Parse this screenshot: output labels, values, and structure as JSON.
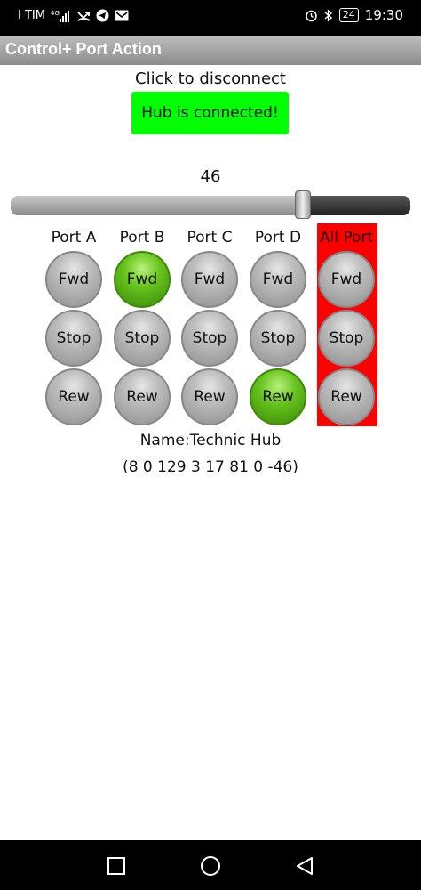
{
  "status": {
    "carrier": "I TIM",
    "network": "4G",
    "battery": "24",
    "time": "19:30"
  },
  "appbar": {
    "title": "Control+ Port Action"
  },
  "connection": {
    "hint": "Click to disconnect",
    "button_label": "Hub is connected!"
  },
  "speed": {
    "value_label": "46",
    "value": 46,
    "min": -100,
    "max": 100
  },
  "ports": [
    {
      "label": "Port A",
      "fwd": "Fwd",
      "stop": "Stop",
      "rew": "Rew",
      "active": "none"
    },
    {
      "label": "Port B",
      "fwd": "Fwd",
      "stop": "Stop",
      "rew": "Rew",
      "active": "fwd"
    },
    {
      "label": "Port C",
      "fwd": "Fwd",
      "stop": "Stop",
      "rew": "Rew",
      "active": "none"
    },
    {
      "label": "Port D",
      "fwd": "Fwd",
      "stop": "Stop",
      "rew": "Rew",
      "active": "rew"
    },
    {
      "label": "All Port",
      "fwd": "Fwd",
      "stop": "Stop",
      "rew": "Rew",
      "active": "none"
    }
  ],
  "hub": {
    "name_line": "Name:Technic Hub",
    "data_line": "(8 0 129 3 17 81 0 -46)"
  },
  "colors": {
    "connected": "#00ff00",
    "active_button": "#66c21c",
    "all_port_bg": "#ff0000"
  }
}
